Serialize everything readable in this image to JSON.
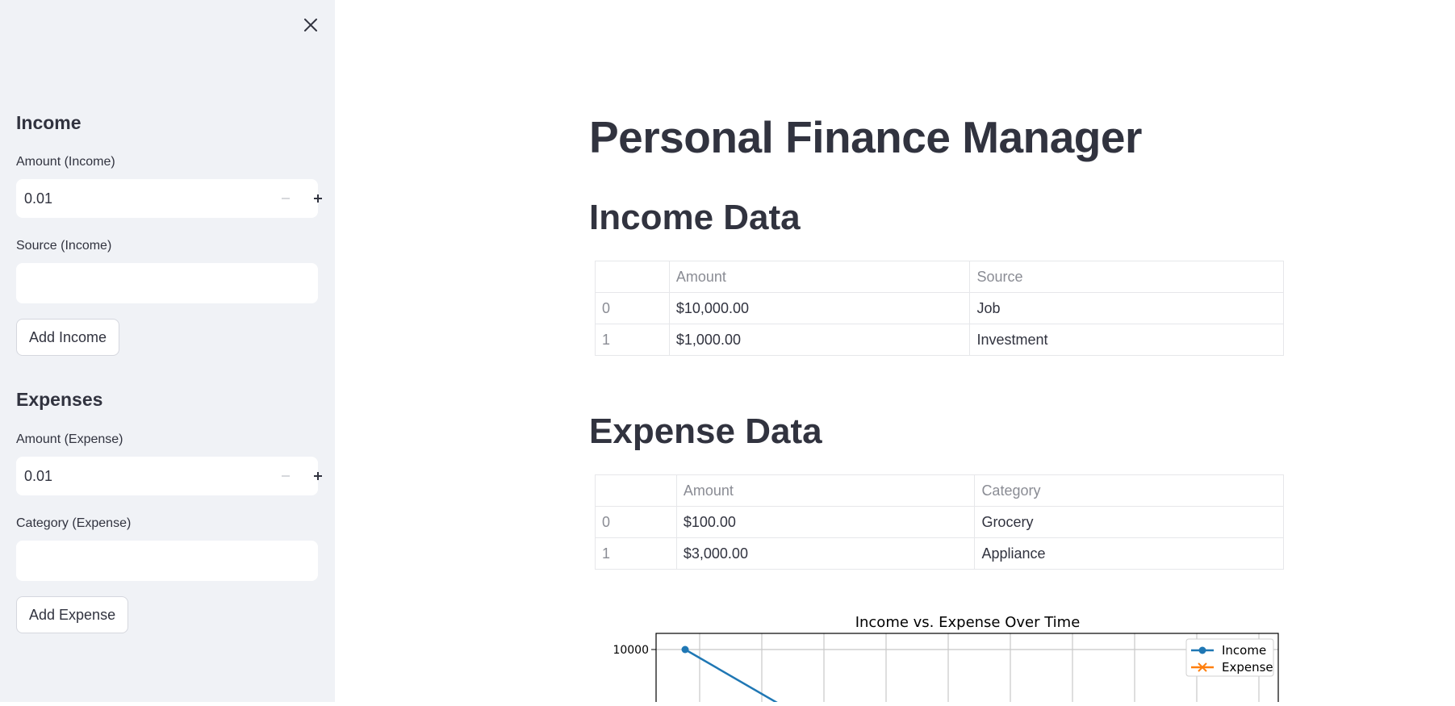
{
  "sidebar": {
    "income": {
      "heading": "Income",
      "amount_label": "Amount (Income)",
      "amount_value": "0.01",
      "source_label": "Source (Income)",
      "source_value": "",
      "button_label": "Add Income"
    },
    "expenses": {
      "heading": "Expenses",
      "amount_label": "Amount (Expense)",
      "amount_value": "0.01",
      "category_label": "Category (Expense)",
      "category_value": "",
      "button_label": "Add Expense"
    }
  },
  "main": {
    "title": "Personal Finance Manager",
    "income_section": {
      "title": "Income Data",
      "columns": [
        "",
        "Amount",
        "Source"
      ],
      "rows": [
        {
          "index": "0",
          "amount": "$10,000.00",
          "source": "Job"
        },
        {
          "index": "1",
          "amount": "$1,000.00",
          "source": "Investment"
        }
      ]
    },
    "expense_section": {
      "title": "Expense Data",
      "columns": [
        "",
        "Amount",
        "Category"
      ],
      "rows": [
        {
          "index": "0",
          "amount": "$100.00",
          "category": "Grocery"
        },
        {
          "index": "1",
          "amount": "$3,000.00",
          "category": "Appliance"
        }
      ]
    }
  },
  "colors": {
    "sidebar_bg": "#f0f2f6",
    "text": "#31333f",
    "income_series": "#1f77b4",
    "expense_series": "#ff7f0e"
  },
  "chart_data": {
    "type": "line",
    "title": "Income vs. Expense Over Time",
    "ytick_labels": [
      "10000"
    ],
    "grid": true,
    "legend_placement": "top-right",
    "series": [
      {
        "name": "Income",
        "marker": "circle",
        "values": [
          10000
        ]
      },
      {
        "name": "Expense",
        "marker": "x",
        "values": []
      }
    ]
  }
}
